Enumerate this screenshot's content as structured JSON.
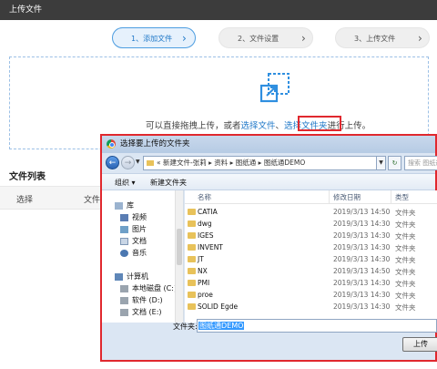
{
  "window": {
    "title": "上传文件"
  },
  "steps": [
    {
      "label": "1、添加文件"
    },
    {
      "label": "2、文件设置"
    },
    {
      "label": "3、上传文件"
    }
  ],
  "dropzone": {
    "text_before": "可以直接拖拽上传，或者",
    "link_file": "选择文件",
    "separator": "、",
    "link_folder": "选择文件夹",
    "text_after": "进行上传。"
  },
  "filelist": {
    "title": "文件列表",
    "columns": [
      "选择",
      "文件"
    ]
  },
  "dialog": {
    "title": "选择要上传的文件夹",
    "address": {
      "separator": "«",
      "path": [
        "新建文件-张莉",
        "资料",
        "图纸通",
        "图纸通DEMO"
      ]
    },
    "search_placeholder": "搜索 图纸通",
    "toolbar": {
      "organize": "组织 ▾",
      "new_folder": "新建文件夹"
    },
    "nav": [
      {
        "label": "库",
        "icon": "library-icon",
        "indent": 0
      },
      {
        "label": "视频",
        "icon": "video-icon",
        "indent": 1
      },
      {
        "label": "图片",
        "icon": "picture-icon",
        "indent": 1
      },
      {
        "label": "文档",
        "icon": "document-icon",
        "indent": 1
      },
      {
        "label": "音乐",
        "icon": "music-icon",
        "indent": 1
      },
      {
        "label": "计算机",
        "icon": "computer-icon",
        "indent": 0
      },
      {
        "label": "本地磁盘 (C:)",
        "icon": "disk-icon",
        "indent": 1
      },
      {
        "label": "软件 (D:)",
        "icon": "disk-icon",
        "indent": 1
      },
      {
        "label": "文档 (E:)",
        "icon": "disk-icon",
        "indent": 1
      }
    ],
    "columns": {
      "name": "名称",
      "date": "修改日期",
      "type": "类型"
    },
    "files": [
      {
        "name": "CATIA",
        "date": "2019/3/13 14:50",
        "type": "文件夹"
      },
      {
        "name": "dwg",
        "date": "2019/3/13 14:30",
        "type": "文件夹"
      },
      {
        "name": "IGES",
        "date": "2019/3/13 14:30",
        "type": "文件夹"
      },
      {
        "name": "INVENT",
        "date": "2019/3/13 14:30",
        "type": "文件夹"
      },
      {
        "name": "JT",
        "date": "2019/3/13 14:30",
        "type": "文件夹"
      },
      {
        "name": "NX",
        "date": "2019/3/13 14:50",
        "type": "文件夹"
      },
      {
        "name": "PMI",
        "date": "2019/3/13 14:30",
        "type": "文件夹"
      },
      {
        "name": "proe",
        "date": "2019/3/13 14:30",
        "type": "文件夹"
      },
      {
        "name": "SOLID Egde",
        "date": "2019/3/13 14:30",
        "type": "文件夹"
      }
    ],
    "filename_label": "文件夹:",
    "filename_value": "图纸通DEMO",
    "upload_button": "上传"
  },
  "colors": {
    "accent": "#1f78c8",
    "highlight": "#e0282e",
    "folder": "#e8c25a"
  }
}
